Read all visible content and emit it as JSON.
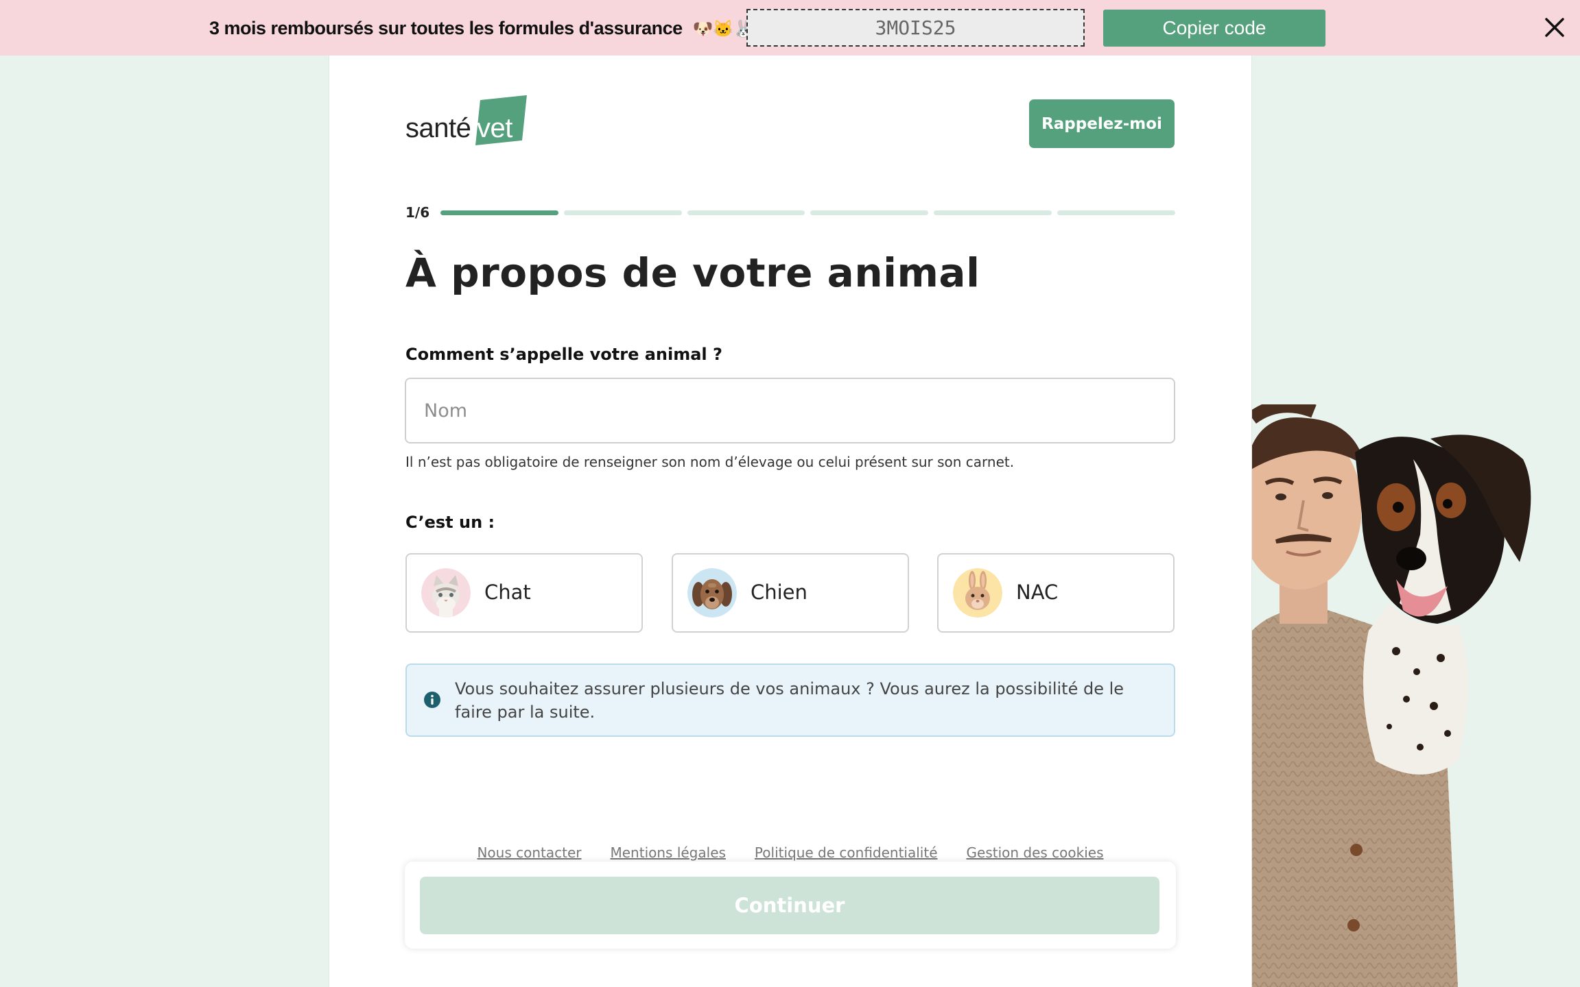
{
  "promo": {
    "text": "3 mois remboursés sur toutes les formules d'assurance",
    "emojis": [
      "🐶",
      "🐱",
      "🐰"
    ],
    "code": "3MOIS25",
    "copy_label": "Copier code"
  },
  "header": {
    "logo_sante": "santé",
    "logo_vet": "vet",
    "callback_label": "Rappelez-moi"
  },
  "progress": {
    "label": "1/6",
    "current_step": 1,
    "total_steps": 6
  },
  "form": {
    "title": "À propos de votre animal",
    "name_label": "Comment s’appelle votre animal ?",
    "name_placeholder": "Nom",
    "name_value": "",
    "name_hint": "Il n’est pas obligatoire de renseigner son nom d’élevage ou celui présent sur son carnet.",
    "type_label": "C’est un :",
    "options": [
      {
        "label": "Chat",
        "icon": "cat-avatar-icon"
      },
      {
        "label": "Chien",
        "icon": "dog-avatar-icon"
      },
      {
        "label": "NAC",
        "icon": "rabbit-avatar-icon"
      }
    ],
    "info_text": "Vous souhaitez assurer plusieurs de vos animaux ? Vous aurez la possibilité de le faire par la suite."
  },
  "footer": {
    "links": [
      "Nous contacter",
      "Mentions légales",
      "Politique de confidentialité",
      "Gestion des cookies"
    ],
    "continue_label": "Continuer"
  },
  "colors": {
    "brand_green": "#55a07d",
    "page_bg": "#e8f3ee",
    "promo_bg": "#f8d7dc",
    "continue_disabled": "#cde3d8",
    "info_bg": "#e9f4fa"
  }
}
